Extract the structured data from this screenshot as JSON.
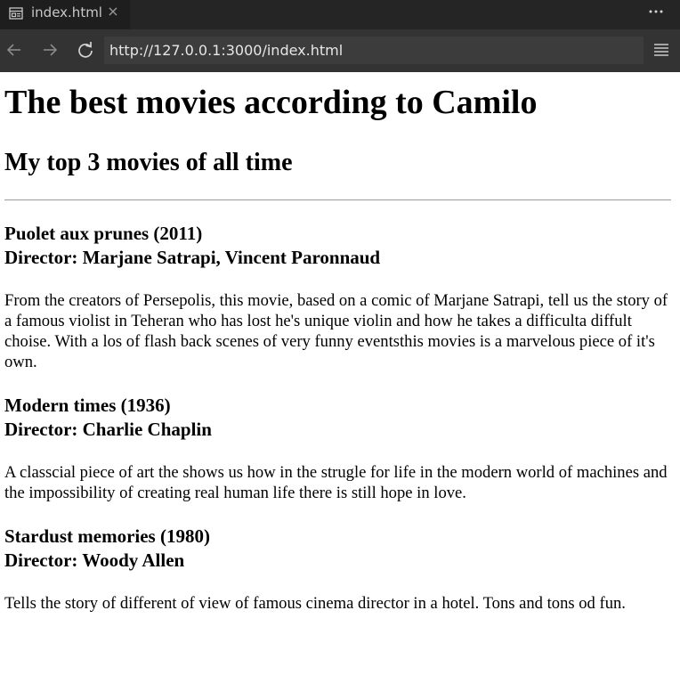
{
  "tab": {
    "title": "index.html",
    "close_glyph": "×",
    "icon": "browser-preview-icon"
  },
  "toolbar": {
    "more_icon": "ellipsis-icon",
    "back_icon": "arrow-left-icon",
    "forward_icon": "arrow-right-icon",
    "reload_icon": "reload-icon",
    "url": "http://127.0.0.1:3000/index.html",
    "menu_icon": "hamburger-menu-icon"
  },
  "page": {
    "heading": "The best movies according to Camilo",
    "subheading": "My top 3 movies of all time",
    "movies": [
      {
        "title": "Puolet aux prunes (2011)",
        "director": "Director: Marjane Satrapi, Vincent Paronnaud",
        "description": "From the creators of Persepolis, this movie, based on a comic of Marjane Satrapi, tell us the story of a famous violist in Teheran who has lost he's unique violin and how he takes a difficulta diffult choise. With a los of flash back scenes of very funny eventsthis movies is a marvelous piece of it's own."
      },
      {
        "title": "Modern times (1936)",
        "director": "Director: Charlie Chaplin",
        "description": "A classcial piece of art the shows us how in the strugle for life in the modern world of machines and the impossibility of creating real human life there is still hope in love."
      },
      {
        "title": "Stardust memories (1980)",
        "director": "Director: Woody Allen",
        "description": "Tells the story of different of view of famous cinema director in a hotel. Tons and tons od fun."
      }
    ]
  },
  "colors": {
    "tabbar_bg": "#252526",
    "tab_active_bg": "#1e1e1e",
    "navbar_bg": "#333333",
    "urlbar_bg": "#3c3c3c",
    "page_bg": "#ffffff"
  }
}
